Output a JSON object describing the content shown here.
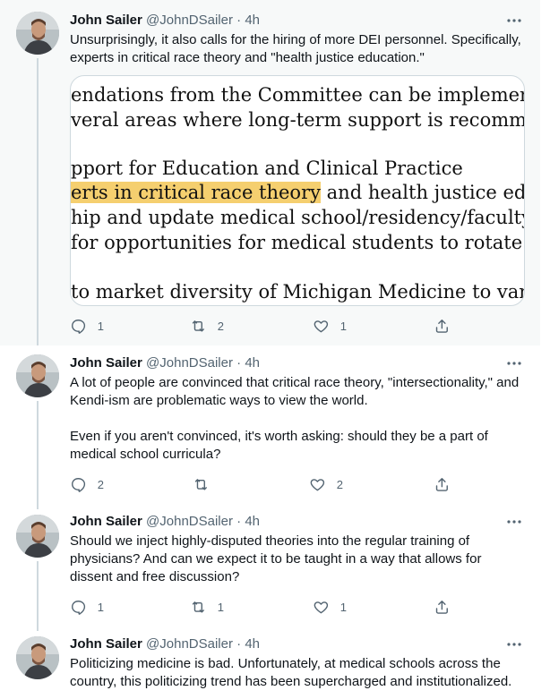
{
  "colors": {
    "text": "#0f1419",
    "secondary": "#536471",
    "highlight": "#f5cf6f",
    "thread": "#cfd9de"
  },
  "tweets": [
    {
      "name": "John Sailer",
      "handle": "@JohnDSailer",
      "dot": "·",
      "time": "4h",
      "paragraphs": [
        "Unsurprisingly, it also calls for the hiring of more DEI personnel. Specifically, experts in critical race theory and \"health justice education.\""
      ],
      "image": {
        "lines": [
          "endations from the Committee can be implemented w",
          "veral areas where long-term support is recommended",
          "pport for Education and Clinical Practice",
          {
            "highlight": "erts in critical race theory",
            "rest": " and health justice education"
          },
          "hip and update medical school/residency/faculty educ",
          "for opportunities for medical students to rotate to Flin",
          "to market diversity of Michigan Medicine to various au"
        ]
      },
      "reply_count": "1",
      "retweet_count": "2",
      "like_count": "1"
    },
    {
      "name": "John Sailer",
      "handle": "@JohnDSailer",
      "dot": "·",
      "time": "4h",
      "paragraphs": [
        "A lot of people are convinced that critical race theory, \"intersectionality,\" and Kendi-ism are problematic ways to view the world.",
        "Even if you aren't convinced, it's worth asking: should they be a part of medical school curricula?"
      ],
      "reply_count": "2",
      "retweet_count": "",
      "like_count": "2"
    },
    {
      "name": "John Sailer",
      "handle": "@JohnDSailer",
      "dot": "·",
      "time": "4h",
      "paragraphs": [
        "Should we inject highly-disputed theories into the regular training of physicians? And can we expect it to be taught in a way that allows for dissent and free discussion?"
      ],
      "reply_count": "1",
      "retweet_count": "1",
      "like_count": "1"
    },
    {
      "name": "John Sailer",
      "handle": "@JohnDSailer",
      "dot": "·",
      "time": "4h",
      "paragraphs": [
        "Politicizing medicine is bad. Unfortunately, at medical schools across the country, this politicizing trend has been supercharged and institutionalized."
      ]
    }
  ]
}
